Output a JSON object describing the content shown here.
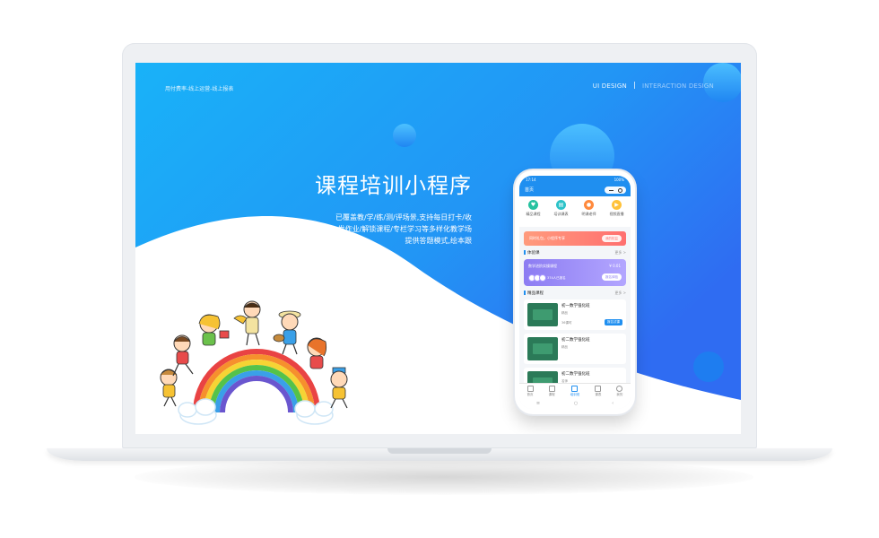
{
  "screen": {
    "top_left_caption": "用付费率-线上运营-线上报表",
    "nav": {
      "ui_design": "UI DESIGN",
      "interaction_design": "INTERACTION DESIGN"
    },
    "headline": "课程培训小程序",
    "description_lines": [
      "已覆盖教/学/练/测/评场景,支持每日打卡/收",
      "发作业/解锁课程/专栏学习等多样化教学场",
      "提供答题模式,绘本跟"
    ]
  },
  "phone": {
    "status_time": "17:14",
    "status_right": "100%",
    "header_title": "首页",
    "icons": [
      {
        "label": "精品课程",
        "color": "#26c2a0",
        "glyph": "♥"
      },
      {
        "label": "培训课表",
        "color": "#2cc2c8",
        "glyph": "▤"
      },
      {
        "label": "明课老师",
        "color": "#ff8a3d",
        "glyph": "●"
      },
      {
        "label": "视频直播",
        "color": "#ffc23a",
        "glyph": "▶"
      }
    ],
    "banner_text": "同时礼包，小程序专享",
    "banner_button": "我的权益",
    "section_trial": {
      "title": "体验课",
      "more": "更多 >"
    },
    "lesson": {
      "title": "数学进阶实操课程",
      "price": "¥ 0.01",
      "count": "374人已报名",
      "button": "报名体验"
    },
    "section_featured": {
      "title": "精品课程",
      "more": "更多 >"
    },
    "courses": [
      {
        "name": "初一数学强化班",
        "sub": "精品",
        "meta": "36课时",
        "button": "报名试课"
      },
      {
        "name": "初二数学强化班",
        "sub": "精品",
        "meta": "",
        "button": ""
      },
      {
        "name": "初二数学强化班",
        "sub": "名师",
        "meta": "",
        "button": ""
      }
    ],
    "tabs": [
      {
        "label": "首页",
        "active": false
      },
      {
        "label": "课程",
        "active": false
      },
      {
        "label": "培训班",
        "active": true
      },
      {
        "label": "课表",
        "active": false
      },
      {
        "label": "我的",
        "active": false
      }
    ],
    "nav_glyphs": [
      "≡",
      "○",
      "‹"
    ]
  },
  "colors": {
    "brand_blue": "#1f8ff0",
    "gradient_start": "#1aa8f7",
    "gradient_end": "#2f6ff2"
  }
}
